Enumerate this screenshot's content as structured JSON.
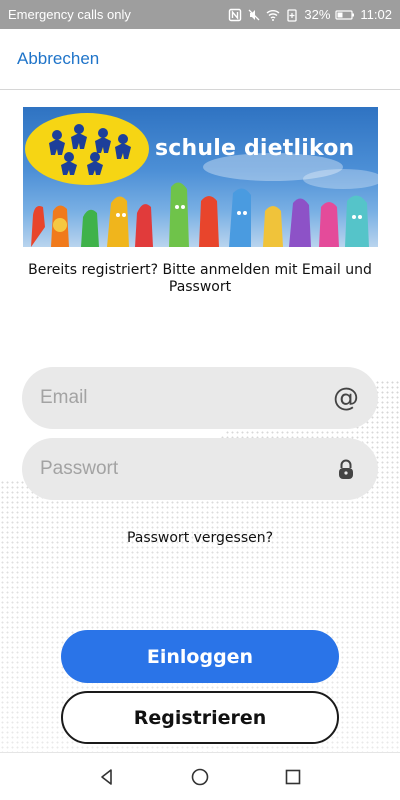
{
  "status_bar": {
    "carrier_text": "Emergency calls only",
    "battery": "32%",
    "time": "11:02",
    "icons": [
      "nfc-icon",
      "mute-icon",
      "wifi-icon",
      "battery-saver-icon",
      "battery-icon"
    ]
  },
  "header": {
    "cancel_label": "Abbrechen",
    "accent_color": "#1f74c9"
  },
  "banner": {
    "title": "schule dietlikon"
  },
  "intro_text": "Bereits registriert? Bitte anmelden mit Email und Passwort",
  "form": {
    "email_placeholder": "Email",
    "email_icon": "@",
    "password_placeholder": "Passwort",
    "password_icon": "lock-icon"
  },
  "forgot_password_label": "Passwort vergessen?",
  "buttons": {
    "login_label": "Einloggen",
    "login_color": "#2a74e8",
    "register_label": "Registrieren"
  },
  "nav_bar": {
    "icons": [
      "back-icon",
      "home-icon",
      "recents-icon"
    ]
  }
}
